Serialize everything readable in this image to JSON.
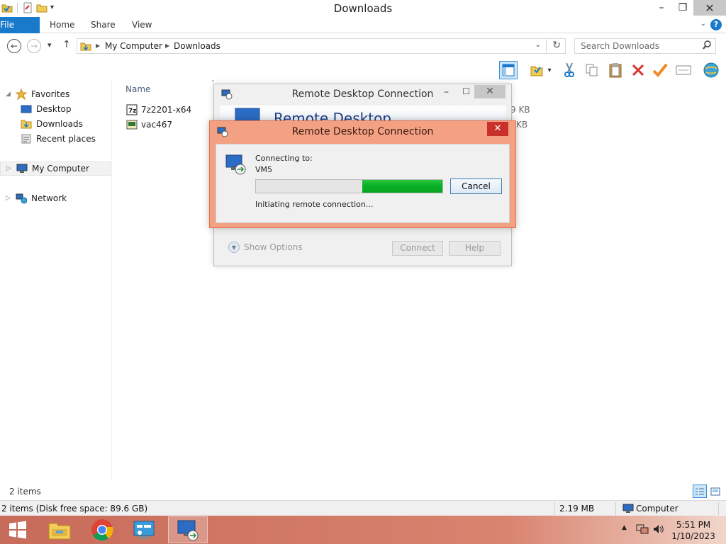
{
  "window": {
    "title": "Downloads",
    "controls": {
      "minimize": "–",
      "maximize": "❐",
      "close": "✕"
    }
  },
  "ribbon": {
    "tabs": [
      "File",
      "Home",
      "Share",
      "View"
    ],
    "help": "?"
  },
  "address": {
    "crumbs": [
      "My Computer",
      "Downloads"
    ],
    "search_placeholder": "Search Downloads"
  },
  "nav_pane": {
    "favorites_label": "Favorites",
    "favorites": [
      "Desktop",
      "Downloads",
      "Recent places"
    ],
    "my_computer": "My Computer",
    "network": "Network"
  },
  "content": {
    "column_name": "Name",
    "files": [
      {
        "name": "7z2201-x64",
        "size": "9 KB"
      },
      {
        "name": "vac467",
        "size": "KB"
      }
    ]
  },
  "rdc_main": {
    "title": "Remote Desktop Connection",
    "banner": "Remote Desktop",
    "show_options": "Show Options",
    "connect": "Connect",
    "help": "Help"
  },
  "rdc_connecting": {
    "title": "Remote Desktop Connection",
    "connecting_label": "Connecting to:",
    "target": "VM5",
    "status": "Initiating remote connection...",
    "cancel": "Cancel",
    "progress_fraction": 0.43
  },
  "status": {
    "items": "2 items",
    "disk_info": "2 items (Disk free space: 89.6 GB)",
    "size": "2.19 MB",
    "location": "Computer"
  },
  "taskbar": {
    "time": "5:51 PM",
    "date": "1/10/2023"
  },
  "colors": {
    "accent": "#1979ca",
    "dialog_frame": "#f3a083",
    "progress": "#06b025",
    "close_red": "#c9302c"
  }
}
